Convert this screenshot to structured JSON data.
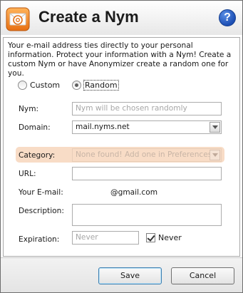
{
  "window": {
    "title": "Create a Nym",
    "help_label": "?"
  },
  "intro": {
    "text": "Your e-mail address ties directly to your personal information. Protect your information with a Nym!  Create a custom Nym or have Anonymizer create a random one for you."
  },
  "mode": {
    "options": [
      {
        "label": "Custom",
        "selected": false
      },
      {
        "label": "Random",
        "selected": true
      }
    ]
  },
  "form": {
    "nym": {
      "label": "Nym:",
      "placeholder": "Nym will be chosen randomly"
    },
    "domain": {
      "label": "Domain:",
      "value": "mail.nyms.net"
    },
    "category": {
      "label": "Category:",
      "value": "None found! Add one in Preferences."
    },
    "url": {
      "label": "URL:",
      "value": ""
    },
    "email": {
      "label": "Your E-mail:",
      "value": "@gmail.com"
    },
    "description": {
      "label": "Description:",
      "value": ""
    },
    "expiration": {
      "label": "Expiration:",
      "placeholder": "Never",
      "never_label": "Never",
      "never_checked": true
    }
  },
  "footer": {
    "save_label": "Save",
    "cancel_label": "Cancel"
  },
  "colors": {
    "category_highlight": "#f8dcc6",
    "help_button": "#1d4fb4",
    "default_button_border": "#3c7fb1"
  },
  "icons": {
    "app_logo": "email-at-icon",
    "help": "help-icon"
  }
}
